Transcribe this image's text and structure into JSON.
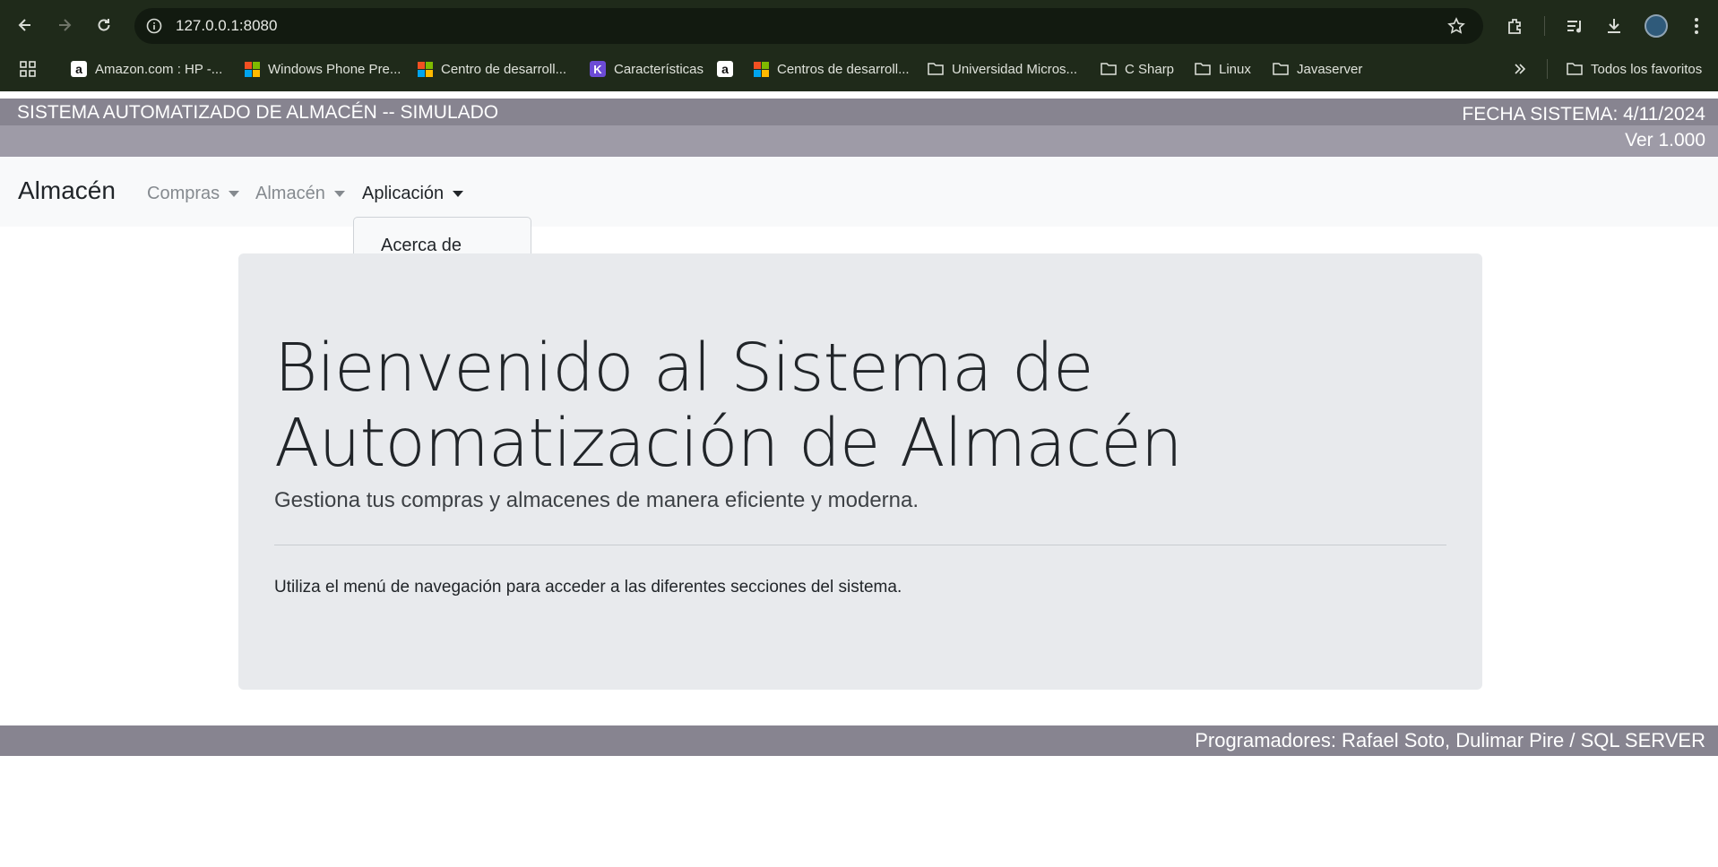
{
  "browser": {
    "url": "127.0.0.1:8080",
    "bookmarks": [
      {
        "label": "Amazon.com : HP -...",
        "icon": "amazon-icon"
      },
      {
        "label": "Windows Phone Pre...",
        "icon": "microsoft-icon"
      },
      {
        "label": "Centro de desarroll...",
        "icon": "microsoft-icon"
      },
      {
        "label": "Características",
        "icon": "k-icon"
      },
      {
        "label": "",
        "icon": "amazon-icon"
      },
      {
        "label": "Centros de desarroll...",
        "icon": "microsoft-icon"
      },
      {
        "label": "Universidad Micros...",
        "icon": "folder-icon"
      },
      {
        "label": "C Sharp",
        "icon": "folder-icon"
      },
      {
        "label": "Linux",
        "icon": "folder-icon"
      },
      {
        "label": "Javaserver",
        "icon": "folder-icon"
      }
    ],
    "all_bookmarks_label": "Todos los favoritos"
  },
  "header": {
    "system_title": "SISTEMA AUTOMATIZADO DE ALMACÉN -- SIMULADO",
    "system_date": "FECHA SISTEMA: 4/11/2024",
    "version": "Ver 1.000"
  },
  "navbar": {
    "brand": "Almacén",
    "items": [
      {
        "label": "Compras",
        "active": false
      },
      {
        "label": "Almacén",
        "active": false
      },
      {
        "label": "Aplicación",
        "active": true
      }
    ],
    "dropdown": {
      "items": [
        "Acerca de"
      ]
    }
  },
  "main": {
    "title": "Bienvenido al Sistema de Automatización de Almacén",
    "lead": "Gestiona tus compras y almacenes de manera eficiente y moderna.",
    "text": "Utiliza el menú de navegación para acceder a las diferentes secciones del sistema."
  },
  "footer": {
    "text": "Programadores: Rafael Soto, Dulimar Pire / SQL SERVER"
  },
  "colors": {
    "header_bar": "#878490",
    "header_bar_light": "#9e9ba7",
    "navbar_bg": "#f8f9fa",
    "jumbotron_bg": "#e8eaed",
    "browser_bg": "#1f2a1a"
  }
}
